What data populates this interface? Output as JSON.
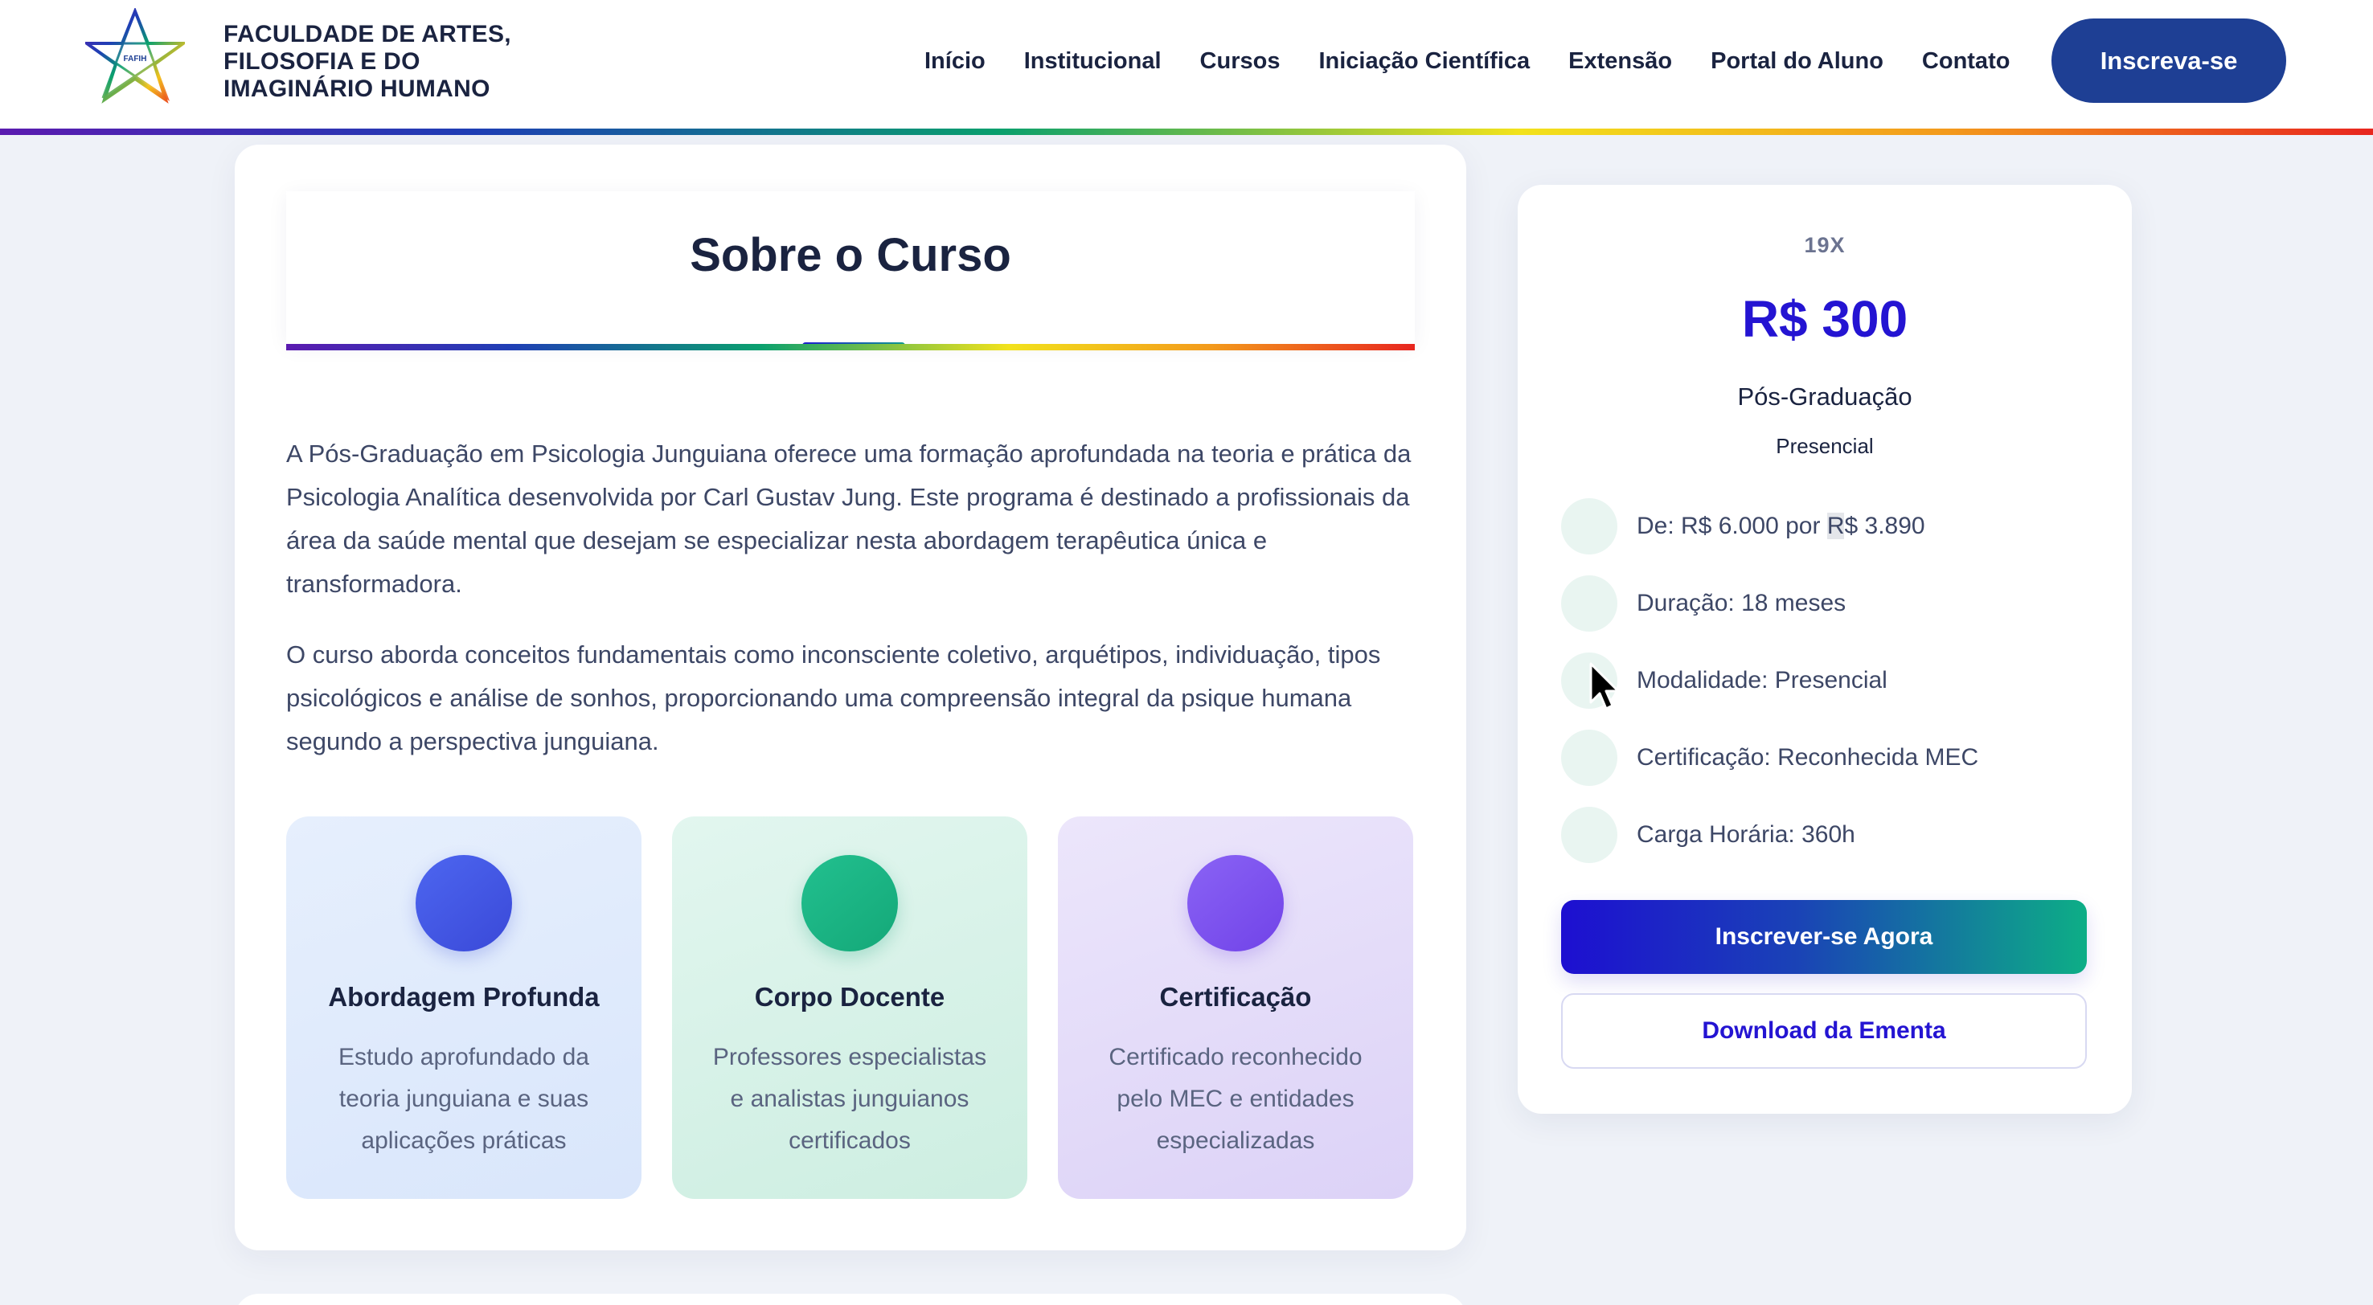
{
  "header": {
    "logo_text_lines": [
      "FACULDADE DE ARTES,",
      "FILOSOFIA E DO",
      "IMAGINÁRIO HUMANO"
    ],
    "logo_badge": "FAFIH",
    "nav": [
      "Início",
      "Institucional",
      "Cursos",
      "Iniciação Científica",
      "Extensão",
      "Portal do Aluno",
      "Contato"
    ],
    "cta": "Inscreva-se"
  },
  "about": {
    "title": "Sobre o Curso",
    "paragraphs": [
      "A Pós-Graduação em Psicologia Junguiana oferece uma formação aprofundada na teoria e prática da Psicologia Analítica desenvolvida por Carl Gustav Jung. Este programa é destinado a profissionais da área da saúde mental que desejam se especializar nesta abordagem terapêutica única e transformadora.",
      "O curso aborda conceitos fundamentais como inconsciente coletivo, arquétipos, individuação, tipos psicológicos e análise de sonhos, proporcionando uma compreensão integral da psique humana segundo a perspectiva junguiana."
    ],
    "features": [
      {
        "title": "Abordagem Profunda",
        "text": "Estudo aprofundado da teoria junguiana e suas aplicações práticas"
      },
      {
        "title": "Corpo Docente",
        "text": "Professores especialistas e analistas junguianos certificados"
      },
      {
        "title": "Certificação",
        "text": "Certificado reconhecido pelo MEC e entidades especializadas"
      }
    ]
  },
  "sidebar": {
    "installments": "19X",
    "price": "R$ 300",
    "course_type": "Pós-Graduação",
    "modality": "Presencial",
    "info_items": [
      {
        "prefix": "De: R$ 6.000 por ",
        "highlight": "R",
        "suffix": "$ 3.890"
      },
      {
        "prefix": "Duração: 18 meses",
        "highlight": "",
        "suffix": ""
      },
      {
        "prefix": "Modalidade: Presencial",
        "highlight": "",
        "suffix": ""
      },
      {
        "prefix": "Certificação: Reconhecida MEC",
        "highlight": "",
        "suffix": ""
      },
      {
        "prefix": "Carga Horária: 360h",
        "highlight": "",
        "suffix": ""
      }
    ],
    "primary_button": "Inscrever-se Agora",
    "secondary_button": "Download da Ementa"
  },
  "colors": {
    "primary_blue": "#1e3f94",
    "price_purple": "#2414d2",
    "accent_teal": "#0dae86",
    "text_dark": "#1a2340"
  }
}
